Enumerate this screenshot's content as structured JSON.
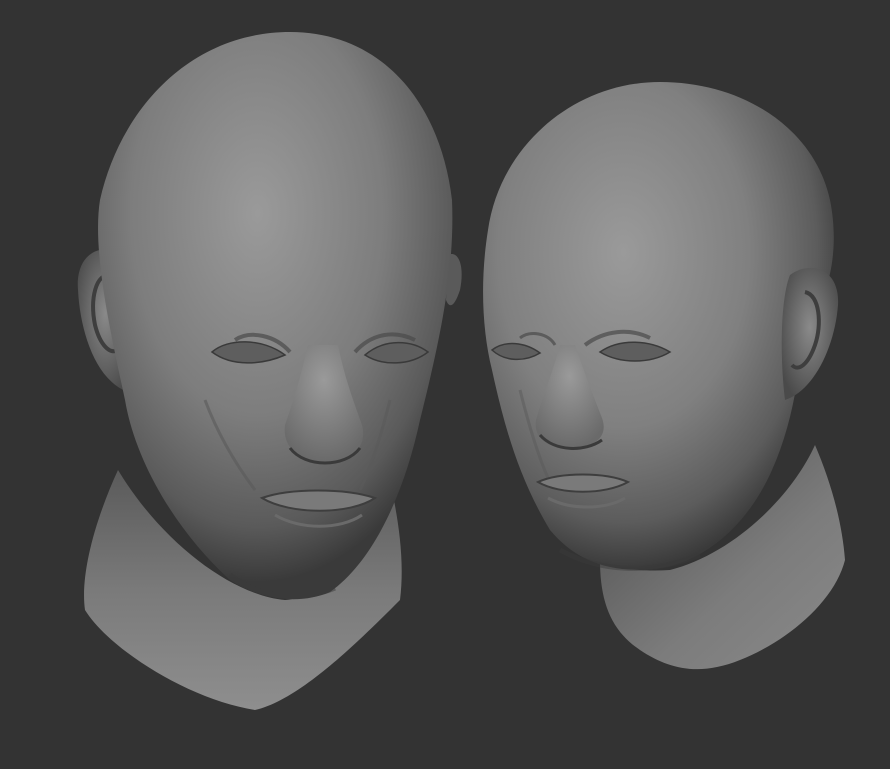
{
  "scene": {
    "background_color": "#333333",
    "material_color": "#8a8a8a",
    "subjects": [
      {
        "name": "head-front-view"
      },
      {
        "name": "head-three-quarter-view"
      }
    ]
  }
}
